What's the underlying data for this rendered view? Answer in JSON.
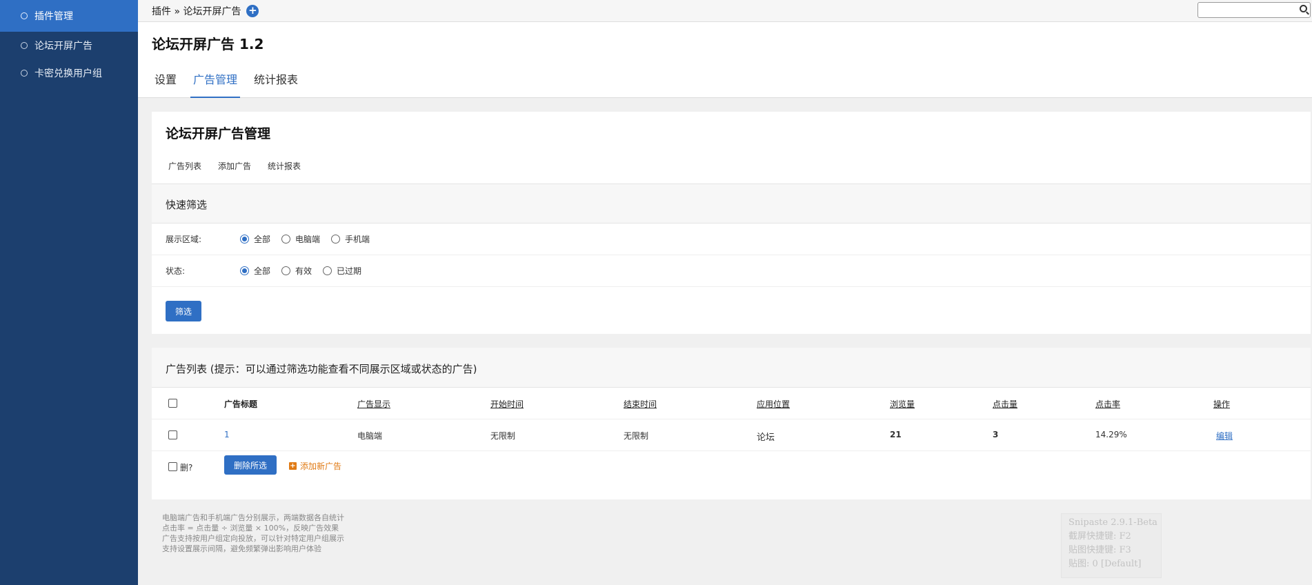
{
  "sidebar": {
    "items": [
      {
        "label": "插件管理"
      },
      {
        "label": "论坛开屏广告"
      },
      {
        "label": "卡密兑换用户组"
      }
    ]
  },
  "topbar": {
    "breadcrumb": "插件 » 论坛开屏广告",
    "add_icon": "plus-circle-icon",
    "search_placeholder": ""
  },
  "header": {
    "title": "论坛开屏广告 1.2",
    "tabs": [
      {
        "label": "设置"
      },
      {
        "label": "广告管理"
      },
      {
        "label": "统计报表"
      }
    ]
  },
  "manage": {
    "title": "论坛开屏广告管理",
    "subnav": [
      "广告列表",
      "添加广告",
      "统计报表"
    ],
    "filter": {
      "heading": "快速筛选",
      "rows": [
        {
          "label": "展示区域:",
          "options": [
            "全部",
            "电脑端",
            "手机端"
          ],
          "selected": "全部"
        },
        {
          "label": "状态:",
          "options": [
            "全部",
            "有效",
            "已过期"
          ],
          "selected": "全部"
        }
      ],
      "button": "筛选"
    }
  },
  "ad_list": {
    "heading": "广告列表 (提示：可以通过筛选功能查看不同展示区域或状态的广告)",
    "columns": [
      "广告标题",
      "广告显示",
      "开始时间",
      "结束时间",
      "应用位置",
      "浏览量",
      "点击量",
      "点击率",
      "操作"
    ],
    "rows": [
      {
        "title": "1",
        "display": "电脑端",
        "start": "无限制",
        "end": "无限制",
        "position": "论坛",
        "views": "21",
        "clicks": "3",
        "ctr": "14.29%",
        "action": "编辑"
      }
    ],
    "delete_label": "删?",
    "delete_button": "删除所选",
    "add_link": "添加新广告"
  },
  "notes": [
    "电脑端广告和手机端广告分别展示，两端数据各自统计",
    "点击率 = 点击量 ÷ 浏览量 × 100%，反映广告效果",
    "广告支持按用户组定向投放，可以针对特定用户组展示",
    "支持设置展示间隔，避免频繁弹出影响用户体验"
  ],
  "snipaste": {
    "lines": [
      "Snipaste 2.9.1-Beta",
      "截屏快捷键: F2",
      "贴图快捷键: F3",
      "贴图: 0 [Default]"
    ]
  },
  "colors": {
    "sidebar_bg": "#1c3f6e",
    "accent": "#2f6fc4",
    "add_link": "#e07a14"
  }
}
